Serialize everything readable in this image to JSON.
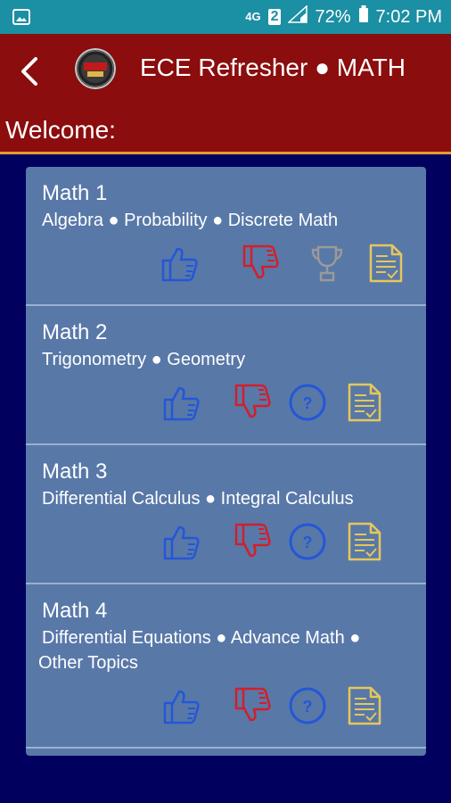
{
  "status_bar": {
    "network": "4G",
    "sim": "2",
    "battery": "72%",
    "time": "7:02 PM"
  },
  "header": {
    "title": "ECE Refresher ● MATH",
    "welcome": "Welcome:"
  },
  "cards": [
    {
      "title": "Math 1",
      "subtitle": "Algebra ● Probability ● Discrete Math",
      "third_icon": "trophy-icon"
    },
    {
      "title": "Math 2",
      "subtitle": "Trigonometry ● Geometry",
      "third_icon": "help-icon"
    },
    {
      "title": "Math 3",
      "subtitle": "Differential Calculus ● Integral Calculus",
      "third_icon": "help-icon"
    },
    {
      "title": "Math 4",
      "subtitle_line1": "Differential Equations ● Advance Math ●",
      "subtitle_line2": "Other Topics",
      "third_icon": "help-icon"
    }
  ],
  "colors": {
    "status_bar": "#1b8fa3",
    "app_bar": "#8b0d0d",
    "accent_line": "#e39a2f",
    "background": "#02005e",
    "card": "#5878a8",
    "like_blue": "#2457d6",
    "dislike_red": "#d21f2b",
    "doc_yellow": "#e5c75a"
  }
}
